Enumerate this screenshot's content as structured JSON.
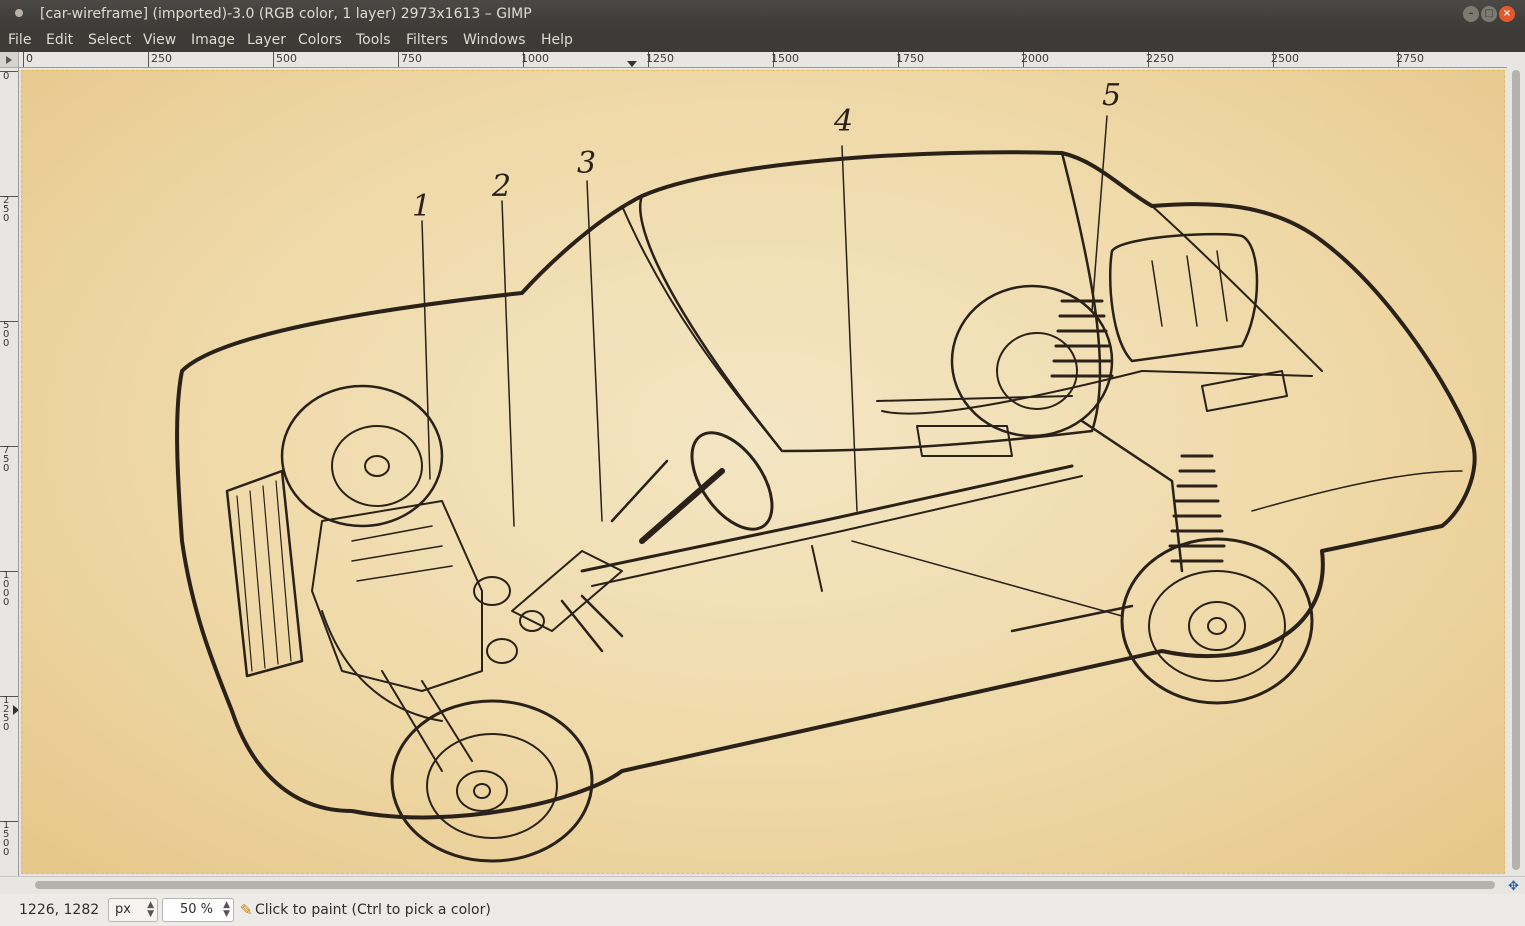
{
  "window": {
    "title": "[car-wireframe] (imported)-3.0 (RGB color, 1 layer) 2973x1613 – GIMP",
    "minimize_icon": "minimize-icon",
    "maximize_icon": "maximize-icon",
    "close_icon": "close-icon"
  },
  "menu": [
    "File",
    "Edit",
    "Select",
    "View",
    "Image",
    "Layer",
    "Colors",
    "Tools",
    "Filters",
    "Windows",
    "Help"
  ],
  "rulers": {
    "horizontal": [
      "0",
      "250",
      "500",
      "750",
      "1000",
      "1250",
      "1500",
      "1750",
      "2000",
      "2250",
      "2500",
      "2750"
    ],
    "vertical": [
      "0",
      "250",
      "500",
      "750",
      "1000",
      "1250",
      "1500"
    ]
  },
  "image": {
    "callouts": [
      "1",
      "2",
      "3",
      "4",
      "5"
    ],
    "colors": {
      "paper": "#efd9a8",
      "ink": "#2a2118"
    }
  },
  "status": {
    "coords": "1226, 1282",
    "unit": "px",
    "zoom": "50 %",
    "message": "Click to paint (Ctrl to pick a color)",
    "tool_icon": "pencil-icon"
  }
}
